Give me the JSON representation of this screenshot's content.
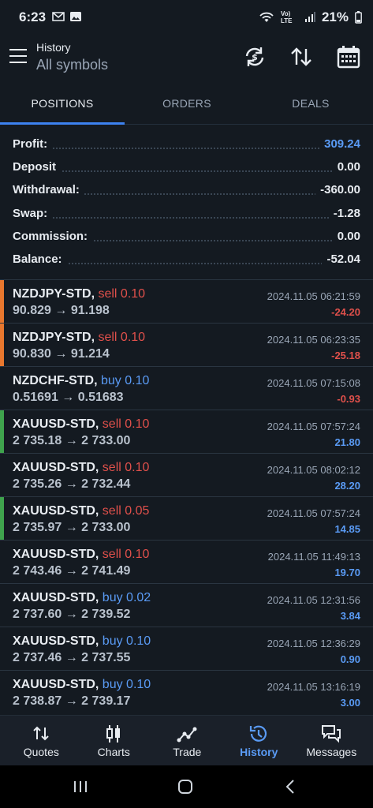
{
  "status_bar": {
    "time": "6:23",
    "battery": "21%",
    "network": "Vo) LTE"
  },
  "header": {
    "title": "History",
    "subtitle": "All symbols"
  },
  "tabs": [
    {
      "label": "POSITIONS",
      "active": true
    },
    {
      "label": "ORDERS",
      "active": false
    },
    {
      "label": "DEALS",
      "active": false
    }
  ],
  "summary": [
    {
      "label": "Profit:",
      "value": "309.24",
      "highlight": true
    },
    {
      "label": "Deposit",
      "value": "0.00",
      "highlight": false
    },
    {
      "label": "Withdrawal:",
      "value": "-360.00",
      "highlight": false
    },
    {
      "label": "Swap:",
      "value": "-1.28",
      "highlight": false
    },
    {
      "label": "Commission:",
      "value": "0.00",
      "highlight": false
    },
    {
      "label": "Balance:",
      "value": "-52.04",
      "highlight": false
    }
  ],
  "positions": [
    {
      "symbol": "NZDJPY-STD,",
      "side": "sell 0.10",
      "type": "sell",
      "prices": "90.829 → 91.198",
      "time": "2024.11.05 06:21:59",
      "pnl": "-24.20",
      "marker": "#e8772e"
    },
    {
      "symbol": "NZDJPY-STD,",
      "side": "sell 0.10",
      "type": "sell",
      "prices": "90.830 → 91.214",
      "time": "2024.11.05 06:23:35",
      "pnl": "-25.18",
      "marker": "#e8772e"
    },
    {
      "symbol": "NZDCHF-STD,",
      "side": "buy 0.10",
      "type": "buy",
      "prices": "0.51691 → 0.51683",
      "time": "2024.11.05 07:15:08",
      "pnl": "-0.93",
      "marker": ""
    },
    {
      "symbol": "XAUUSD-STD,",
      "side": "sell 0.10",
      "type": "sell",
      "prices": "2 735.18 → 2 733.00",
      "time": "2024.11.05 07:57:24",
      "pnl": "21.80",
      "marker": "#3fa34d"
    },
    {
      "symbol": "XAUUSD-STD,",
      "side": "sell 0.10",
      "type": "sell",
      "prices": "2 735.26 → 2 732.44",
      "time": "2024.11.05 08:02:12",
      "pnl": "28.20",
      "marker": ""
    },
    {
      "symbol": "XAUUSD-STD,",
      "side": "sell 0.05",
      "type": "sell",
      "prices": "2 735.97 → 2 733.00",
      "time": "2024.11.05 07:57:24",
      "pnl": "14.85",
      "marker": "#3fa34d"
    },
    {
      "symbol": "XAUUSD-STD,",
      "side": "sell 0.10",
      "type": "sell",
      "prices": "2 743.46 → 2 741.49",
      "time": "2024.11.05 11:49:13",
      "pnl": "19.70",
      "marker": ""
    },
    {
      "symbol": "XAUUSD-STD,",
      "side": "buy 0.02",
      "type": "buy",
      "prices": "2 737.60 → 2 739.52",
      "time": "2024.11.05 12:31:56",
      "pnl": "3.84",
      "marker": ""
    },
    {
      "symbol": "XAUUSD-STD,",
      "side": "buy 0.10",
      "type": "buy",
      "prices": "2 737.46 → 2 737.55",
      "time": "2024.11.05 12:36:29",
      "pnl": "0.90",
      "marker": ""
    },
    {
      "symbol": "XAUUSD-STD,",
      "side": "buy 0.10",
      "type": "buy",
      "prices": "2 738.87 → 2 739.17",
      "time": "2024.11.05 13:16:19",
      "pnl": "3.00",
      "marker": ""
    }
  ],
  "bottom_nav": [
    {
      "label": "Quotes",
      "icon": "quotes-icon",
      "active": false
    },
    {
      "label": "Charts",
      "icon": "charts-icon",
      "active": false
    },
    {
      "label": "Trade",
      "icon": "trade-icon",
      "active": false
    },
    {
      "label": "History",
      "icon": "history-icon",
      "active": true
    },
    {
      "label": "Messages",
      "icon": "messages-icon",
      "active": false
    }
  ],
  "colors": {
    "accent": "#3d82f0",
    "sell": "#e0504b",
    "buy": "#5a9bf5",
    "background": "#141a21"
  }
}
